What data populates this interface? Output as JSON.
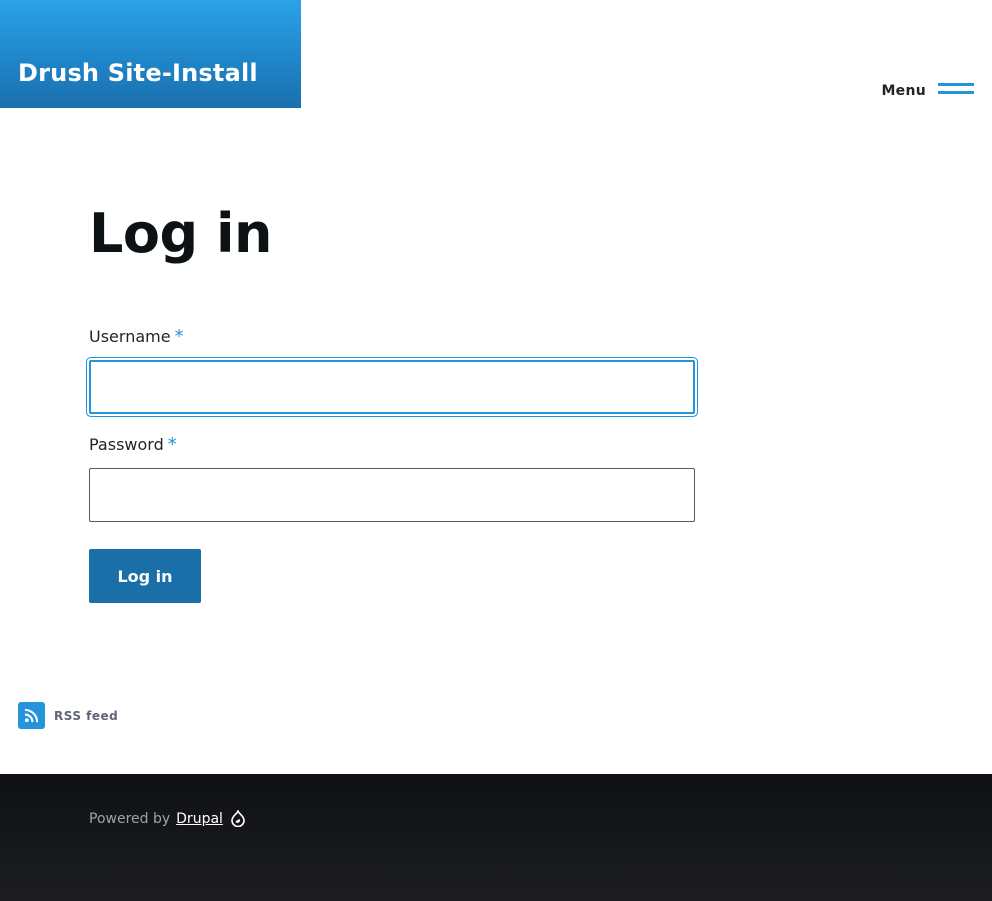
{
  "header": {
    "site_name": "Drush Site-Install",
    "menu_label": "Menu"
  },
  "main": {
    "title": "Log in",
    "form": {
      "username": {
        "label": "Username",
        "required_marker": "*",
        "value": ""
      },
      "password": {
        "label": "Password",
        "required_marker": "*",
        "value": ""
      },
      "submit_label": "Log in"
    }
  },
  "rss": {
    "label": "RSS feed",
    "icon": "rss-icon"
  },
  "footer": {
    "powered_by": "Powered by",
    "drupal_link": "Drupal",
    "icon": "drupal-drop-icon"
  },
  "colors": {
    "brand_blue": "#2494db",
    "button_blue": "#1b6fa8",
    "footer_dark": "#1c1d21",
    "title_text": "#0d1214"
  }
}
